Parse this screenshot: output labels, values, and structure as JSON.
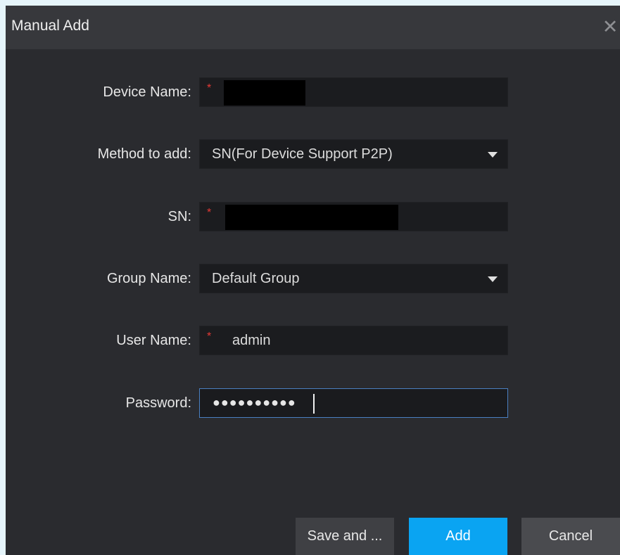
{
  "dialog": {
    "title": "Manual Add",
    "close_icon": "close-icon"
  },
  "form": {
    "device_name": {
      "label": "Device Name:",
      "required_mark": "*",
      "value": ""
    },
    "method": {
      "label": "Method to add:",
      "value": "SN(For Device Support P2P)"
    },
    "sn": {
      "label": "SN:",
      "required_mark": "*",
      "value": ""
    },
    "group": {
      "label": "Group Name:",
      "value": "Default Group"
    },
    "user": {
      "label": "User Name:",
      "required_mark": "*",
      "value": "admin"
    },
    "password": {
      "label": "Password:",
      "masked_value": "●●●●●●●●●●"
    }
  },
  "buttons": {
    "save_label": "Save and ...",
    "add_label": "Add",
    "cancel_label": "Cancel"
  },
  "colors": {
    "accent": "#0aa4f2",
    "required": "#e53935",
    "background": "#2a2b2f",
    "field": "#1b1c1f"
  }
}
